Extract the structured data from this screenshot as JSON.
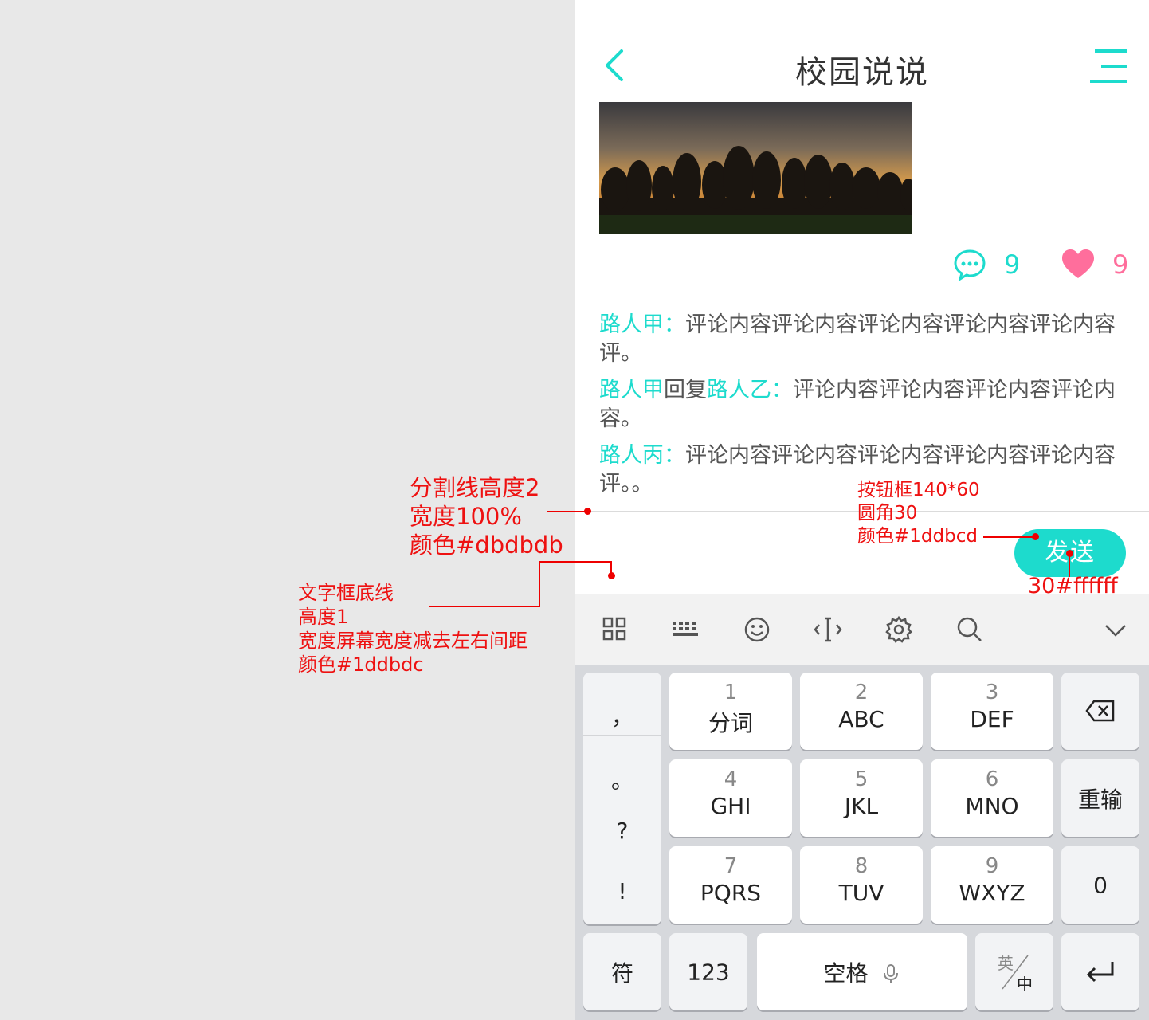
{
  "header": {
    "title": "校园说说"
  },
  "post": {
    "comment_count": "9",
    "like_count": "9"
  },
  "comments": [
    {
      "name": "路人甲",
      "sep": "：",
      "text": "评论内容评论内容评论内容评论内容评论内容评。"
    },
    {
      "name": "路人甲",
      "reply_word": "回复",
      "reply_to": "路人乙",
      "sep": "：",
      "text": "评论内容评论内容评论内容评论内容。"
    },
    {
      "name": "路人丙",
      "sep": "：",
      "text": "评论内容评论内容评论内容评论内容评论内容评。。"
    }
  ],
  "compose": {
    "send_label": "发送"
  },
  "keyboard": {
    "punct": [
      "，",
      "。",
      "?",
      "!"
    ],
    "keys": [
      {
        "n": "1",
        "l": "分词"
      },
      {
        "n": "2",
        "l": "ABC"
      },
      {
        "n": "3",
        "l": "DEF"
      },
      {
        "n": "4",
        "l": "GHI"
      },
      {
        "n": "5",
        "l": "JKL"
      },
      {
        "n": "6",
        "l": "MNO"
      },
      {
        "n": "7",
        "l": "PQRS"
      },
      {
        "n": "8",
        "l": "TUV"
      },
      {
        "n": "9",
        "l": "WXYZ"
      }
    ],
    "reenter": "重输",
    "zero": "0",
    "symbol": "符",
    "num": "123",
    "space": "空格",
    "lang_top": "英",
    "lang_bottom": "中"
  },
  "annotations": {
    "divider": [
      "分割线高度2",
      "宽度100%",
      "颜色#dbdbdb"
    ],
    "input_line": [
      "文字框底线",
      "高度1",
      "宽度屏幕宽度减去左右间距",
      "颜色#1ddbdc"
    ],
    "button": [
      "按钮框140*60",
      "圆角30",
      "颜色#1ddbcd"
    ],
    "button_text": "30#ffffff"
  },
  "colors": {
    "accent": "#1ddbcd",
    "like": "#ff6e9c",
    "divider": "#dbdbdb",
    "input_line": "#1ddbdc",
    "annotation": "#ee1111"
  }
}
